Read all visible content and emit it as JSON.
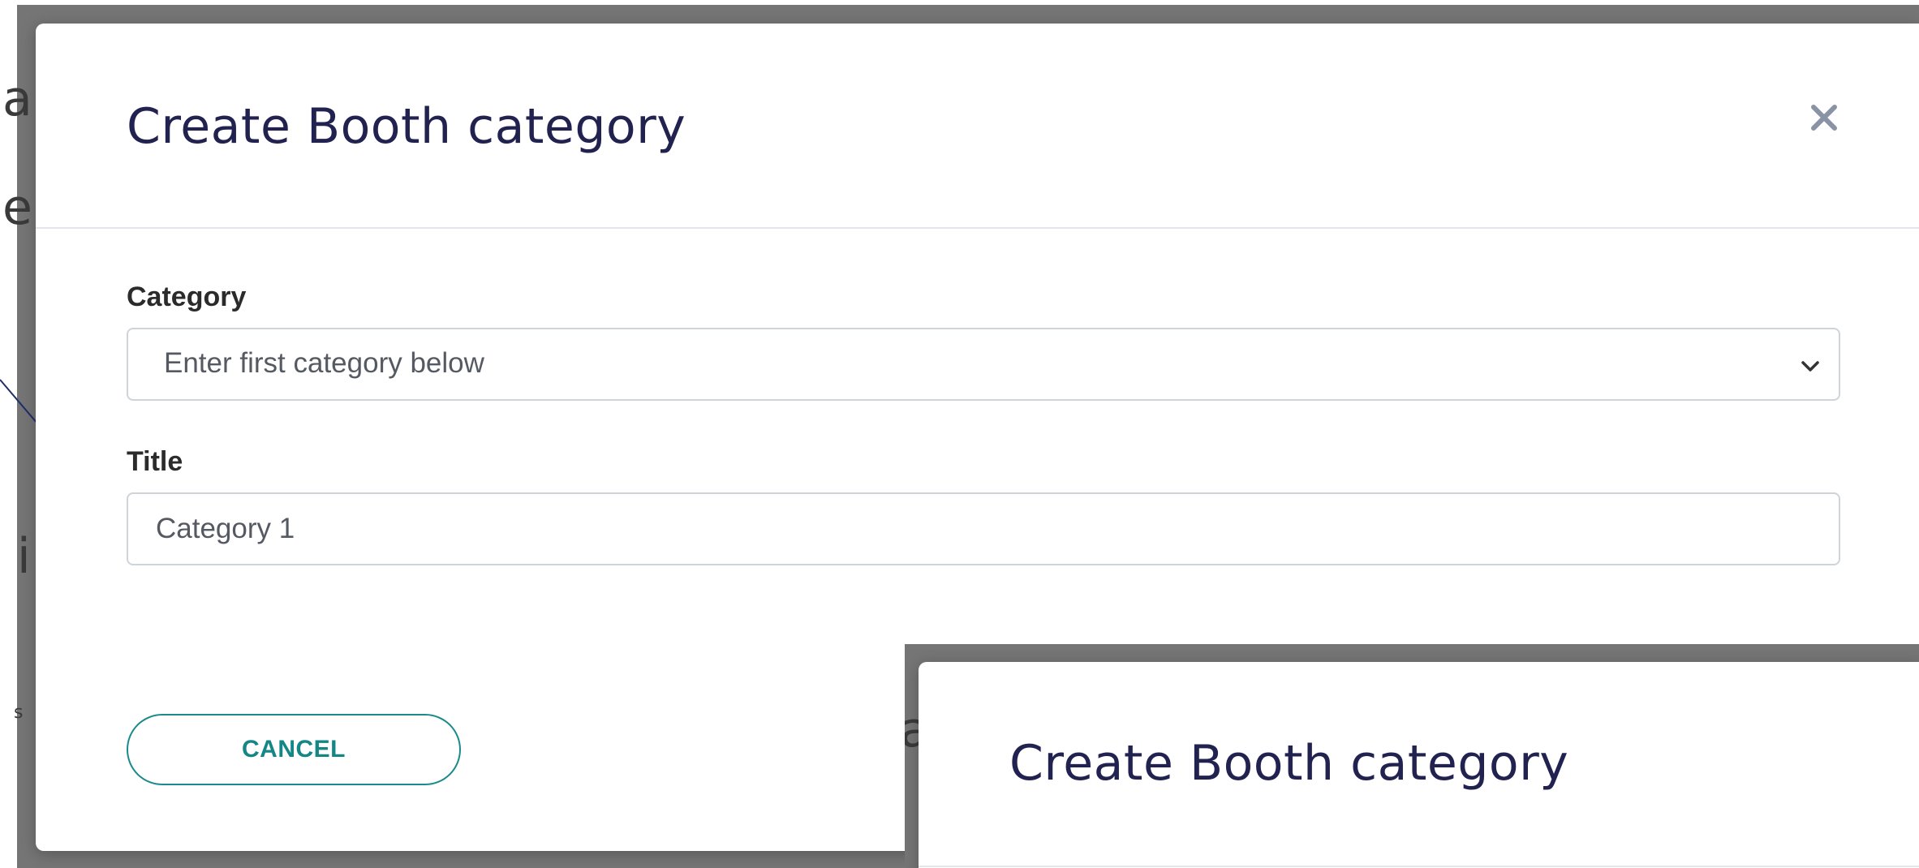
{
  "modal": {
    "title": "Create Booth category",
    "close_icon": "close-icon",
    "category_label": "Category",
    "category_select_value": "Enter first category below",
    "title_label": "Title",
    "title_input_value": "Category 1",
    "cancel_label": "CANCEL"
  },
  "background_fragments": {
    "frag1": "a",
    "frag2": "e",
    "frag3": "i",
    "frag4": "s"
  },
  "inset": {
    "title": "Create Booth category",
    "fragment": "a"
  },
  "colors": {
    "title": "#222250",
    "accent_teal": "#148686",
    "backdrop": "#757575",
    "border": "#cfd3da"
  }
}
